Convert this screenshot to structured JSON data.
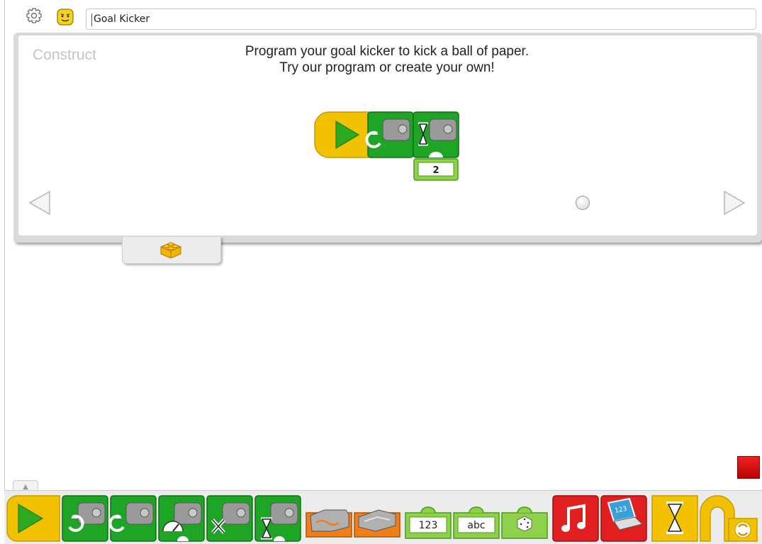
{
  "header": {
    "project_title": "Goal Kicker"
  },
  "panel": {
    "section_label": "Construct",
    "instruction_line1": "Program your goal kicker to kick a ball of paper.",
    "instruction_line2": "Try our program or create your own!",
    "program_blocks": [
      {
        "icon": "start-play-icon",
        "color": "#f2c200"
      },
      {
        "icon": "motor-counterclockwise-icon",
        "color": "#1fa526"
      },
      {
        "icon": "motor-on-for-icon",
        "color": "#1fa526",
        "input_value": "2"
      }
    ]
  },
  "palette": {
    "blocks": [
      {
        "name": "start",
        "icon": "play-icon"
      },
      {
        "name": "motor-clockwise",
        "icon": "motor-clockwise-icon"
      },
      {
        "name": "motor-counterclockwise",
        "icon": "motor-counterclockwise-icon"
      },
      {
        "name": "motor-power",
        "icon": "motor-power-icon"
      },
      {
        "name": "motor-off",
        "icon": "motor-off-icon"
      },
      {
        "name": "motor-on-for",
        "icon": "motor-on-for-icon"
      },
      {
        "name": "tilt-sensor",
        "icon": "tilt-sensor-icon"
      },
      {
        "name": "motion-sensor",
        "icon": "motion-sensor-icon"
      },
      {
        "name": "number-input",
        "label": "123"
      },
      {
        "name": "text-input",
        "label": "abc"
      },
      {
        "name": "random-input",
        "icon": "dice-icon"
      },
      {
        "name": "play-sound",
        "icon": "music-note-icon"
      },
      {
        "name": "display",
        "icon": "laptop-display-icon",
        "label": "123"
      },
      {
        "name": "wait-for",
        "icon": "hourglass-icon"
      },
      {
        "name": "repeat",
        "icon": "loop-icon"
      }
    ]
  },
  "colors": {
    "motor_green": "#1fa526",
    "start_yellow": "#f2c200",
    "sensor_orange": "#f07f1a",
    "sound_red": "#e02020",
    "stop_red": "#d81e1e"
  }
}
